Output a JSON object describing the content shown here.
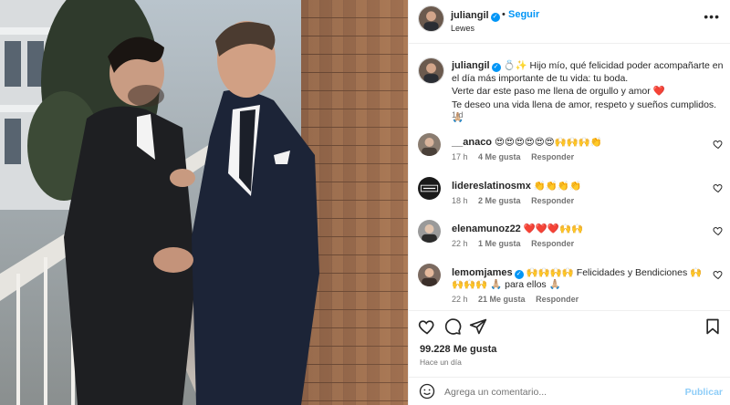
{
  "post": {
    "author": "juliangil",
    "follow_label": "Seguir",
    "separator": "•",
    "location": "Lewes",
    "more_label": "•••"
  },
  "caption": {
    "username": "juliangil",
    "line1": "💍✨ Hijo mío, qué felicidad poder acompañarte en el día más importante de tu vida: tu boda.",
    "line2": "Verte dar este paso me llena de orgullo y amor ❤️",
    "line3": "Te deseo una vida llena de amor, respeto y sueños cumplidos. 🙏🏼",
    "time": "1 d"
  },
  "comments": [
    {
      "username": "__anaco",
      "text": "😍😍😍😍😍😍🙌🙌🙌👏",
      "time": "17 h",
      "likes": "4 Me gusta",
      "reply": "Responder",
      "verified": false
    },
    {
      "username": "lidereslatinosmx",
      "text": "👏👏👏👏",
      "time": "18 h",
      "likes": "2 Me gusta",
      "reply": "Responder",
      "verified": false
    },
    {
      "username": "elenamunoz22",
      "text": "❤️❤️❤️🙌🙌",
      "time": "22 h",
      "likes": "1 Me gusta",
      "reply": "Responder",
      "verified": false
    },
    {
      "username": "lemomjames",
      "text": "🙌🙌🙌🙌 Felicidades y Bendiciones 🙌🙌🙌🙌 🙏🏼 para ellos 🙏🏼",
      "time": "22 h",
      "likes": "21 Me gusta",
      "reply": "Responder",
      "verified": true
    }
  ],
  "actions": {
    "likes_count": "99.228 Me gusta",
    "posted_ago": "Hace un día",
    "comment_placeholder": "Agrega un comentario...",
    "publish_label": "Publicar"
  },
  "colors": {
    "accent": "#0095f6",
    "muted": "#737373",
    "publish_disabled": "#8ecdf8"
  }
}
